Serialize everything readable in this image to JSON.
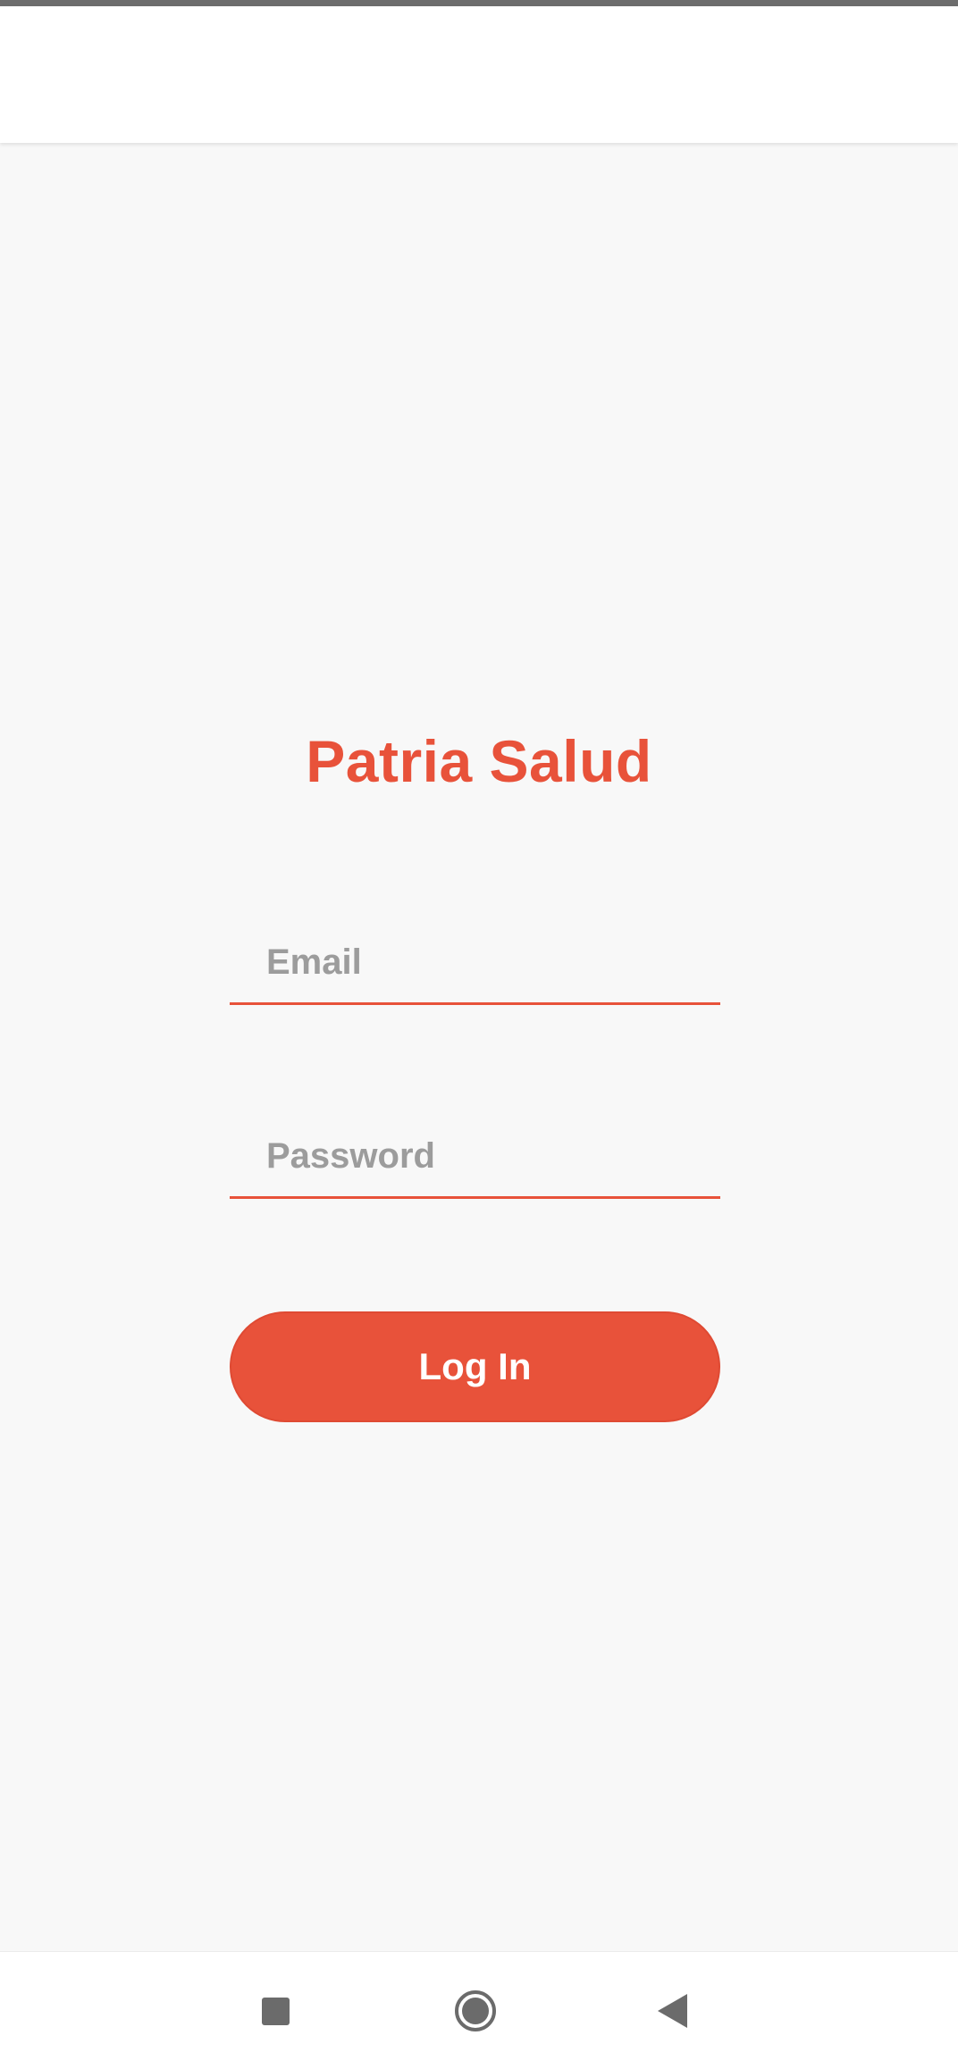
{
  "app": {
    "title": "Patria Salud"
  },
  "login_form": {
    "email_placeholder": "Email",
    "email_value": "",
    "password_placeholder": "Password",
    "password_value": "",
    "submit_label": "Log In"
  },
  "system_nav": {
    "recents_icon": "square-icon",
    "home_icon": "circle-home-icon",
    "back_icon": "triangle-back-icon"
  },
  "colors": {
    "brand": "#e8523a",
    "background": "#f8f8f8",
    "placeholder": "#9c9c9c",
    "nav_icon": "#6b6b6b"
  }
}
